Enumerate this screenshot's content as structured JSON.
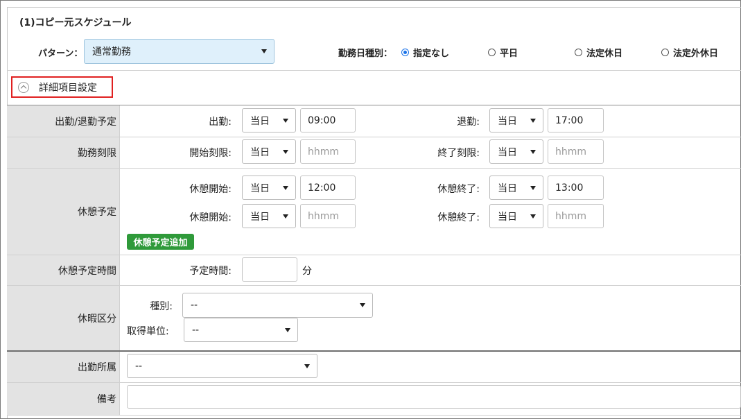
{
  "section": {
    "title": "(1)コピー元スケジュール"
  },
  "pattern": {
    "label": "パターン：",
    "value": "通常勤務"
  },
  "work_day_type": {
    "label": "勤務日種別：",
    "options": [
      {
        "label": "指定なし",
        "checked": true
      },
      {
        "label": "平日",
        "checked": false
      },
      {
        "label": "法定休日",
        "checked": false
      },
      {
        "label": "法定外休日",
        "checked": false
      }
    ]
  },
  "detail_toggle": {
    "label": "詳細項目設定"
  },
  "rows": {
    "schedule": {
      "header": "出勤/退勤予定",
      "start_label": "出勤:",
      "start_day": "当日",
      "start_time": "09:00",
      "end_label": "退勤:",
      "end_day": "当日",
      "end_time": "17:00"
    },
    "limit": {
      "header": "勤務刻限",
      "start_label": "開始刻限:",
      "start_day": "当日",
      "start_placeholder": "hhmm",
      "end_label": "終了刻限:",
      "end_day": "当日",
      "end_placeholder": "hhmm"
    },
    "break": {
      "header": "休憩予定",
      "items": [
        {
          "start_label": "休憩開始:",
          "start_day": "当日",
          "start_time": "12:00",
          "start_placeholder": "",
          "end_label": "休憩終了:",
          "end_day": "当日",
          "end_time": "13:00",
          "end_placeholder": ""
        },
        {
          "start_label": "休憩開始:",
          "start_day": "当日",
          "start_time": "",
          "start_placeholder": "hhmm",
          "end_label": "休憩終了:",
          "end_day": "当日",
          "end_time": "",
          "end_placeholder": "hhmm"
        }
      ],
      "add_button": "休憩予定追加"
    },
    "break_time": {
      "header": "休憩予定時間",
      "label": "予定時間:",
      "value": "",
      "unit": "分"
    },
    "leave": {
      "header": "休暇区分",
      "type_label": "種別:",
      "type_value": "--",
      "unit_label": "取得単位:",
      "unit_value": "--"
    },
    "affiliation": {
      "header": "出勤所属",
      "value": "--"
    },
    "note": {
      "header": "備考",
      "value": ""
    }
  },
  "colors": {
    "header_bg": "#e3e3e3",
    "accent_green": "#2f9a3a",
    "highlight_red": "#e02020",
    "radio_blue": "#1a73e8",
    "pattern_select_bg": "#dff0fb"
  }
}
